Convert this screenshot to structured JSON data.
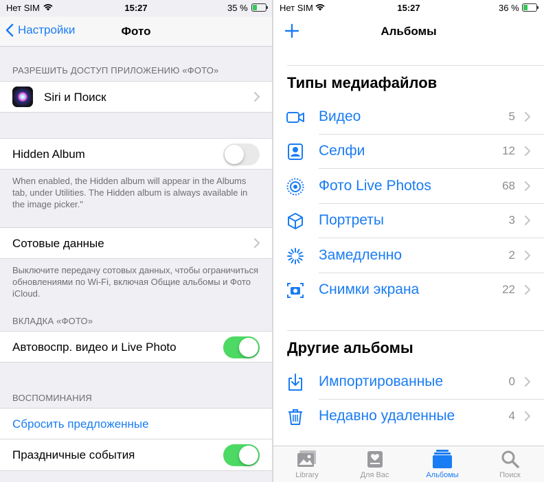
{
  "left_screen": {
    "status": {
      "carrier": "Нет SIM",
      "time": "15:27",
      "battery": "35 %",
      "battery_level": 0.35
    },
    "nav": {
      "back_label": "Настройки",
      "title": "Фото"
    },
    "allow_access": {
      "header": "РАЗРЕШИТЬ ДОСТУП ПРИЛОЖЕНИЮ «ФОТО»",
      "siri_label": "Siri и Поиск"
    },
    "hidden_album": {
      "label": "Hidden Album",
      "enabled": false,
      "note": "When enabled, the Hidden album will appear in the Albums tab, under Utilities. The Hidden album is always available in the image picker.\""
    },
    "cellular": {
      "label": "Сотовые данные",
      "note": "Выключите передачу сотовых данных, чтобы ограничиться обновлениями по Wi‑Fi, включая Общие альбомы и Фото iCloud."
    },
    "photos_tab": {
      "header": "ВКЛАДКА «ФОТО»",
      "autoplay_label": "Автовоспр. видео и Live Photo",
      "autoplay_enabled": true
    },
    "memories": {
      "header": "ВОСПОМИНАНИЯ",
      "reset_label": "Сбросить предложенные",
      "holidays_label": "Праздничные события",
      "holidays_enabled": true
    }
  },
  "right_screen": {
    "status": {
      "carrier": "Нет SIM",
      "time": "15:27",
      "battery": "36 %",
      "battery_level": 0.36
    },
    "nav": {
      "title": "Альбомы"
    },
    "media_types": {
      "header": "Типы медиафайлов",
      "items": [
        {
          "label": "Видео",
          "count": "5",
          "icon": "video-icon"
        },
        {
          "label": "Селфи",
          "count": "12",
          "icon": "selfie-icon"
        },
        {
          "label": "Фото Live Photos",
          "count": "68",
          "icon": "live-photo-icon"
        },
        {
          "label": "Портреты",
          "count": "3",
          "icon": "portrait-cube-icon"
        },
        {
          "label": "Замедленно",
          "count": "2",
          "icon": "slow-motion-icon"
        },
        {
          "label": "Снимки экрана",
          "count": "22",
          "icon": "screenshot-icon"
        }
      ]
    },
    "other_albums": {
      "header": "Другие альбомы",
      "items": [
        {
          "label": "Импортированные",
          "count": "0",
          "icon": "import-icon"
        },
        {
          "label": "Недавно удаленные",
          "count": "4",
          "icon": "trash-icon"
        }
      ]
    },
    "tabbar": {
      "tabs": [
        {
          "label": "Library",
          "icon": "library-icon",
          "active": false
        },
        {
          "label": "Для Вас",
          "icon": "for-you-icon",
          "active": false
        },
        {
          "label": "Альбомы",
          "icon": "albums-icon",
          "active": true
        },
        {
          "label": "Поиск",
          "icon": "search-icon",
          "active": false
        }
      ]
    },
    "accent": "#1a7cf3"
  }
}
